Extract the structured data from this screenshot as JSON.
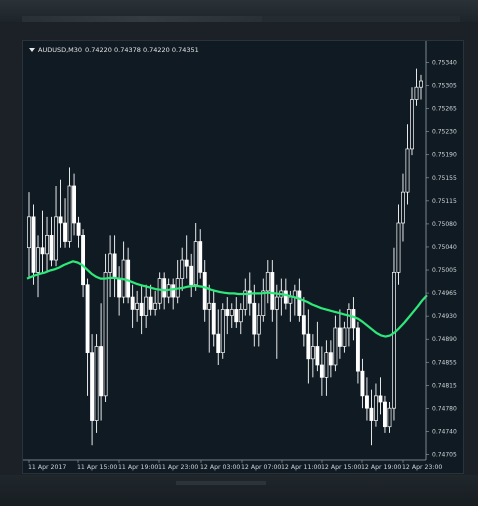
{
  "window": {
    "symbol": "AUDUSD,M30",
    "ohlc": "0.74220 0.74378 0.74220 0.74351"
  },
  "colors": {
    "background": "#0f1a22",
    "candle": "#ffffff",
    "ma_line": "#2ee87a",
    "axis_text": "#d0d6da"
  },
  "chart_data": {
    "type": "line",
    "title": "AUDUSD,M30",
    "y_ticks": [
      "0.75340",
      "0.75305",
      "0.75265",
      "0.75230",
      "0.75190",
      "0.75155",
      "0.75115",
      "0.75080",
      "0.75040",
      "0.75005",
      "0.74965",
      "0.74930",
      "0.74890",
      "0.74855",
      "0.74815",
      "0.74780",
      "0.74740",
      "0.74705"
    ],
    "ylim": [
      0.747,
      0.7535
    ],
    "x_ticks": [
      "11 Apr 2017",
      "11 Apr 15:00",
      "11 Apr 19:00",
      "11 Apr 23:00",
      "12 Apr 03:00",
      "12 Apr 07:00",
      "12 Apr 11:00",
      "12 Apr 15:00",
      "12 Apr 19:00",
      "12 Apr 23:00"
    ],
    "candles": [
      {
        "o": 0.7504,
        "h": 0.7513,
        "l": 0.7499,
        "c": 0.7509
      },
      {
        "o": 0.7509,
        "h": 0.7511,
        "l": 0.7498,
        "c": 0.75
      },
      {
        "o": 0.75,
        "h": 0.7506,
        "l": 0.7496,
        "c": 0.7504
      },
      {
        "o": 0.7504,
        "h": 0.751,
        "l": 0.75,
        "c": 0.7503
      },
      {
        "o": 0.7503,
        "h": 0.7509,
        "l": 0.75,
        "c": 0.7506
      },
      {
        "o": 0.7506,
        "h": 0.7509,
        "l": 0.7501,
        "c": 0.7502
      },
      {
        "o": 0.7502,
        "h": 0.7514,
        "l": 0.7501,
        "c": 0.7509
      },
      {
        "o": 0.7509,
        "h": 0.7515,
        "l": 0.7504,
        "c": 0.7508
      },
      {
        "o": 0.7508,
        "h": 0.7512,
        "l": 0.7504,
        "c": 0.7505
      },
      {
        "o": 0.7505,
        "h": 0.7517,
        "l": 0.7504,
        "c": 0.7514
      },
      {
        "o": 0.7514,
        "h": 0.7516,
        "l": 0.7506,
        "c": 0.7508
      },
      {
        "o": 0.7508,
        "h": 0.7509,
        "l": 0.7504,
        "c": 0.7506
      },
      {
        "o": 0.7506,
        "h": 0.7507,
        "l": 0.7496,
        "c": 0.7498
      },
      {
        "o": 0.7498,
        "h": 0.7499,
        "l": 0.748,
        "c": 0.7487
      },
      {
        "o": 0.7487,
        "h": 0.749,
        "l": 0.7472,
        "c": 0.7476
      },
      {
        "o": 0.7476,
        "h": 0.749,
        "l": 0.7474,
        "c": 0.7488
      },
      {
        "o": 0.7488,
        "h": 0.7495,
        "l": 0.7476,
        "c": 0.748
      },
      {
        "o": 0.748,
        "h": 0.7503,
        "l": 0.7479,
        "c": 0.75
      },
      {
        "o": 0.75,
        "h": 0.7506,
        "l": 0.7496,
        "c": 0.7503
      },
      {
        "o": 0.7503,
        "h": 0.7506,
        "l": 0.7496,
        "c": 0.7499
      },
      {
        "o": 0.7499,
        "h": 0.7501,
        "l": 0.7493,
        "c": 0.7496
      },
      {
        "o": 0.7496,
        "h": 0.7505,
        "l": 0.7495,
        "c": 0.7502
      },
      {
        "o": 0.7502,
        "h": 0.7504,
        "l": 0.7495,
        "c": 0.7496
      },
      {
        "o": 0.7496,
        "h": 0.7498,
        "l": 0.7491,
        "c": 0.7494
      },
      {
        "o": 0.7494,
        "h": 0.7497,
        "l": 0.7492,
        "c": 0.7495
      },
      {
        "o": 0.7495,
        "h": 0.7498,
        "l": 0.749,
        "c": 0.7493
      },
      {
        "o": 0.7493,
        "h": 0.7498,
        "l": 0.7491,
        "c": 0.7496
      },
      {
        "o": 0.7496,
        "h": 0.7498,
        "l": 0.7493,
        "c": 0.7494
      },
      {
        "o": 0.7494,
        "h": 0.7497,
        "l": 0.7493,
        "c": 0.7495
      },
      {
        "o": 0.7495,
        "h": 0.75,
        "l": 0.7494,
        "c": 0.7499
      },
      {
        "o": 0.7499,
        "h": 0.75,
        "l": 0.7494,
        "c": 0.7496
      },
      {
        "o": 0.7496,
        "h": 0.7499,
        "l": 0.7495,
        "c": 0.7498
      },
      {
        "o": 0.7498,
        "h": 0.7499,
        "l": 0.7494,
        "c": 0.7496
      },
      {
        "o": 0.7496,
        "h": 0.7502,
        "l": 0.7495,
        "c": 0.7499
      },
      {
        "o": 0.7499,
        "h": 0.7504,
        "l": 0.7497,
        "c": 0.7502
      },
      {
        "o": 0.7502,
        "h": 0.7506,
        "l": 0.7499,
        "c": 0.7501
      },
      {
        "o": 0.7501,
        "h": 0.7503,
        "l": 0.7496,
        "c": 0.7498
      },
      {
        "o": 0.7498,
        "h": 0.7508,
        "l": 0.7497,
        "c": 0.7505
      },
      {
        "o": 0.7505,
        "h": 0.7507,
        "l": 0.7499,
        "c": 0.75
      },
      {
        "o": 0.75,
        "h": 0.7502,
        "l": 0.7492,
        "c": 0.7494
      },
      {
        "o": 0.7494,
        "h": 0.7498,
        "l": 0.7487,
        "c": 0.7495
      },
      {
        "o": 0.7495,
        "h": 0.7497,
        "l": 0.7488,
        "c": 0.749
      },
      {
        "o": 0.749,
        "h": 0.7494,
        "l": 0.7485,
        "c": 0.7487
      },
      {
        "o": 0.7487,
        "h": 0.7495,
        "l": 0.7486,
        "c": 0.7494
      },
      {
        "o": 0.7494,
        "h": 0.7496,
        "l": 0.749,
        "c": 0.7493
      },
      {
        "o": 0.7493,
        "h": 0.7495,
        "l": 0.7491,
        "c": 0.7494
      },
      {
        "o": 0.7494,
        "h": 0.7496,
        "l": 0.7491,
        "c": 0.7492
      },
      {
        "o": 0.7492,
        "h": 0.7495,
        "l": 0.749,
        "c": 0.7494
      },
      {
        "o": 0.7494,
        "h": 0.7499,
        "l": 0.7493,
        "c": 0.7497
      },
      {
        "o": 0.7497,
        "h": 0.75,
        "l": 0.7493,
        "c": 0.7495
      },
      {
        "o": 0.7495,
        "h": 0.7498,
        "l": 0.7488,
        "c": 0.749
      },
      {
        "o": 0.749,
        "h": 0.7495,
        "l": 0.7488,
        "c": 0.7493
      },
      {
        "o": 0.7493,
        "h": 0.7499,
        "l": 0.7492,
        "c": 0.7497
      },
      {
        "o": 0.7497,
        "h": 0.7502,
        "l": 0.7495,
        "c": 0.75
      },
      {
        "o": 0.75,
        "h": 0.7502,
        "l": 0.7492,
        "c": 0.7494
      },
      {
        "o": 0.7494,
        "h": 0.7498,
        "l": 0.7486,
        "c": 0.7496
      },
      {
        "o": 0.7496,
        "h": 0.7499,
        "l": 0.7493,
        "c": 0.7497
      },
      {
        "o": 0.7497,
        "h": 0.7499,
        "l": 0.7494,
        "c": 0.7495
      },
      {
        "o": 0.7495,
        "h": 0.7497,
        "l": 0.7492,
        "c": 0.7496
      },
      {
        "o": 0.7496,
        "h": 0.7498,
        "l": 0.7493,
        "c": 0.7497
      },
      {
        "o": 0.7497,
        "h": 0.7499,
        "l": 0.7492,
        "c": 0.7493
      },
      {
        "o": 0.7493,
        "h": 0.7496,
        "l": 0.7488,
        "c": 0.749
      },
      {
        "o": 0.749,
        "h": 0.7494,
        "l": 0.7482,
        "c": 0.7486
      },
      {
        "o": 0.7486,
        "h": 0.749,
        "l": 0.7483,
        "c": 0.7488
      },
      {
        "o": 0.7488,
        "h": 0.7492,
        "l": 0.7484,
        "c": 0.7485
      },
      {
        "o": 0.7485,
        "h": 0.7488,
        "l": 0.748,
        "c": 0.7483
      },
      {
        "o": 0.7483,
        "h": 0.7489,
        "l": 0.748,
        "c": 0.7487
      },
      {
        "o": 0.7487,
        "h": 0.7489,
        "l": 0.7483,
        "c": 0.7485
      },
      {
        "o": 0.7485,
        "h": 0.7493,
        "l": 0.7484,
        "c": 0.7491
      },
      {
        "o": 0.7491,
        "h": 0.7494,
        "l": 0.7486,
        "c": 0.7488
      },
      {
        "o": 0.7488,
        "h": 0.7492,
        "l": 0.7487,
        "c": 0.7491
      },
      {
        "o": 0.7491,
        "h": 0.7495,
        "l": 0.7488,
        "c": 0.7494
      },
      {
        "o": 0.7494,
        "h": 0.7496,
        "l": 0.7489,
        "c": 0.7491
      },
      {
        "o": 0.7491,
        "h": 0.7492,
        "l": 0.7482,
        "c": 0.7484
      },
      {
        "o": 0.7484,
        "h": 0.7486,
        "l": 0.7478,
        "c": 0.748
      },
      {
        "o": 0.748,
        "h": 0.7483,
        "l": 0.7476,
        "c": 0.7478
      },
      {
        "o": 0.7478,
        "h": 0.7481,
        "l": 0.7472,
        "c": 0.7476
      },
      {
        "o": 0.7476,
        "h": 0.7482,
        "l": 0.7475,
        "c": 0.748
      },
      {
        "o": 0.748,
        "h": 0.7483,
        "l": 0.7477,
        "c": 0.7479
      },
      {
        "o": 0.7479,
        "h": 0.748,
        "l": 0.7474,
        "c": 0.7475
      },
      {
        "o": 0.7475,
        "h": 0.7479,
        "l": 0.7474,
        "c": 0.7478
      },
      {
        "o": 0.7478,
        "h": 0.7504,
        "l": 0.7476,
        "c": 0.75
      },
      {
        "o": 0.75,
        "h": 0.7511,
        "l": 0.7498,
        "c": 0.7508
      },
      {
        "o": 0.7508,
        "h": 0.7516,
        "l": 0.7505,
        "c": 0.7513
      },
      {
        "o": 0.7513,
        "h": 0.7524,
        "l": 0.7511,
        "c": 0.752
      },
      {
        "o": 0.752,
        "h": 0.753,
        "l": 0.7519,
        "c": 0.7528
      },
      {
        "o": 0.7528,
        "h": 0.7533,
        "l": 0.7527,
        "c": 0.753
      },
      {
        "o": 0.753,
        "h": 0.7532,
        "l": 0.7528,
        "c": 0.7531
      }
    ],
    "moving_average": {
      "values": [
        0.7499,
        0.74993,
        0.74996,
        0.74998,
        0.75,
        0.75003,
        0.75005,
        0.75008,
        0.75012,
        0.75015,
        0.75018,
        0.75016,
        0.75012,
        0.75005,
        0.74998,
        0.74993,
        0.7499,
        0.7499,
        0.74991,
        0.74991,
        0.7499,
        0.74989,
        0.74987,
        0.74984,
        0.74981,
        0.74979,
        0.74977,
        0.74975,
        0.74973,
        0.74972,
        0.74971,
        0.74972,
        0.74973,
        0.74974,
        0.74975,
        0.74977,
        0.74978,
        0.74978,
        0.74977,
        0.74975,
        0.74972,
        0.7497,
        0.74968,
        0.74967,
        0.74966,
        0.74966,
        0.74965,
        0.74965,
        0.74965,
        0.74966,
        0.74966,
        0.74966,
        0.74967,
        0.74967,
        0.74966,
        0.74965,
        0.74964,
        0.74962,
        0.7496,
        0.74958,
        0.74955,
        0.74952,
        0.74948,
        0.74945,
        0.74942,
        0.7494,
        0.74938,
        0.74936,
        0.74934,
        0.74932,
        0.7493,
        0.74928,
        0.74925,
        0.7492,
        0.74914,
        0.74908,
        0.74902,
        0.74898,
        0.74896,
        0.74898,
        0.74903,
        0.7491,
        0.74918,
        0.74927,
        0.74936,
        0.74945,
        0.74955,
        0.74963
      ]
    }
  }
}
